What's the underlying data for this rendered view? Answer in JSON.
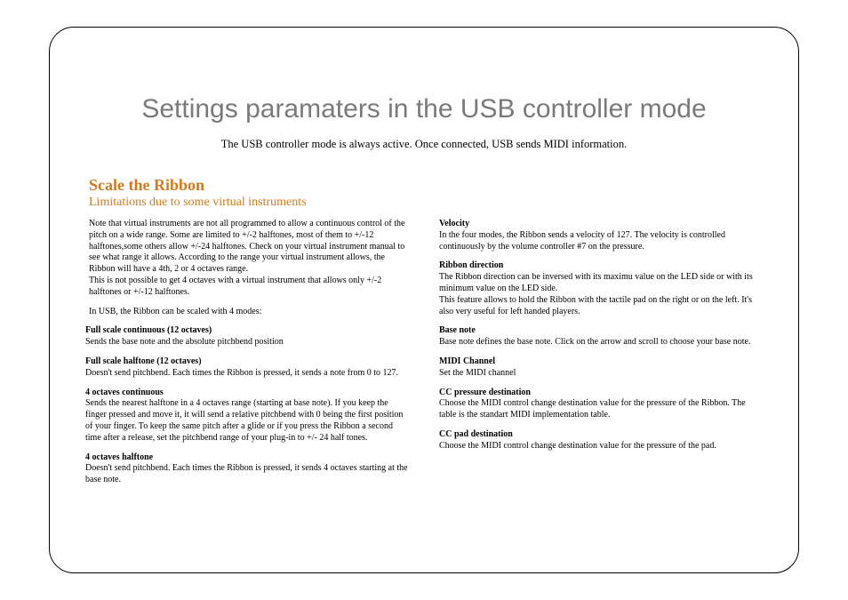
{
  "title": "Settings paramaters in the USB controller mode",
  "subtitle": "The USB controller mode is always active. Once connected, USB sends MIDI information.",
  "section": {
    "heading": "Scale the Ribbon",
    "subheading": "Limitations due to some virtual instruments"
  },
  "left": {
    "intro1": " Note that virtual instruments are not all programmed to allow a continuous control of the pitch on a wide range. Some are limited to +/-2 halftones, most of them to +/-12 halftones,some  others allow +/-24 halftones. Check on your virtual instrument manual to see what range it allows. According to the range your virtual instrument allows, the Ribbon will have a 4th, 2 or 4 octaves range.",
    "intro2": "This is not possible to get 4 octaves with a virtual instrument that allows only +/-2 halftones or  +/-12 halftones.",
    "modesLine": "In USB, the Ribbon can be scaled with 4 modes:",
    "modes": [
      {
        "label": "Full scale continuous (12 octaves)",
        "text": "Sends the base note and the absolute pitchbend position"
      },
      {
        "label": "Full scale halftone (12 octaves)",
        "text": "Doesn't send pitchbend. Each times the Ribbon is pressed, it sends a note from 0 to 127."
      },
      {
        "label": "4 octaves continuous",
        "text": "Sends the nearest halftone in a 4 octaves range (starting at base note). If you keep the finger pressed and move it, it will send a relative pitchbend with 0 being the first  position of your finger. To keep the same pitch after a glide or if you press the Ribbon a second time after a release, set the pitchbend range of your plug-in to +/- 24 half tones."
      },
      {
        "label": "4 octaves halftone",
        "text": "Doesn't send pitchbend. Each times the Ribbon is pressed, it sends 4 octaves starting at the base note."
      }
    ]
  },
  "right": {
    "items": [
      {
        "label": "Velocity",
        "text": "In the four modes, the Ribbon sends a velocity of 127. The velocity is controlled continuously by the volume controller  #7 on the pressure."
      },
      {
        "label": "Ribbon direction",
        "text": "The Ribbon direction can be inversed with its maximu value on the LED side or with its minimum value on the LED side.",
        "text2": "This feature allows to hold the Ribbon with the tactile pad on the right or on the left. It's also very useful for left handed players."
      },
      {
        "label": "Base note",
        "text": "Base note defines the base note. Click on the arrow and scroll to choose your base note."
      },
      {
        "label": "MIDI Channel",
        "text": "Set the MIDI channel"
      },
      {
        "label": "CC pressure destination",
        "text": "Choose the MIDI control change destination value for the pressure of the Ribbon. The table is the standart MIDI implementation table."
      },
      {
        "label": "CC pad destination",
        "text": "Choose the MIDI control change destination value for the pressure of the pad."
      }
    ]
  }
}
